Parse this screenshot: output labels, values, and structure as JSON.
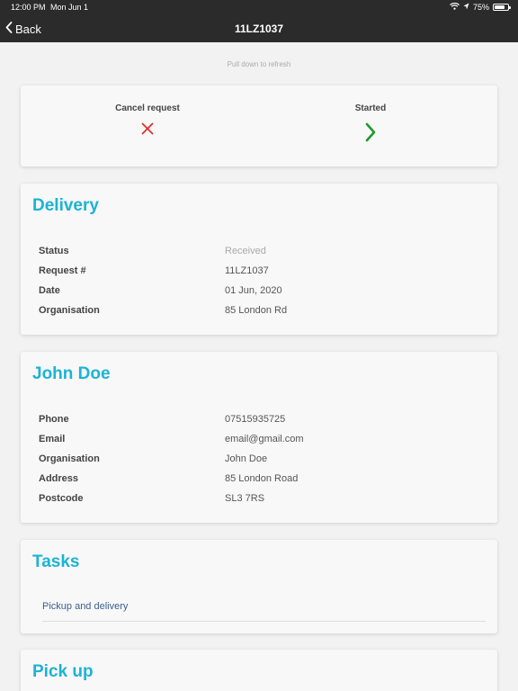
{
  "status_bar": {
    "time": "12:00 PM",
    "date": "Mon Jun 1",
    "battery": "75%"
  },
  "nav": {
    "back_label": "Back",
    "title": "11LZ1037"
  },
  "refresh_hint": "Pull down to refresh",
  "actions": {
    "cancel_label": "Cancel request",
    "started_label": "Started",
    "cancel_color": "#e0302a",
    "started_color": "#1e9a2a"
  },
  "delivery": {
    "title": "Delivery",
    "rows": [
      {
        "label": "Status",
        "value": "Received"
      },
      {
        "label": "Request #",
        "value": "11LZ1037"
      },
      {
        "label": "Date",
        "value": "01 Jun, 2020"
      },
      {
        "label": "Organisation",
        "value": "85 London Rd"
      }
    ]
  },
  "contact": {
    "title": "John Doe",
    "rows": [
      {
        "label": "Phone",
        "value": "07515935725"
      },
      {
        "label": "Email",
        "value": "email@gmail.com"
      },
      {
        "label": "Organisation",
        "value": "John Doe"
      },
      {
        "label": "Address",
        "value": "85 London Road"
      },
      {
        "label": "Postcode",
        "value": "SL3 7RS"
      }
    ]
  },
  "tasks": {
    "title": "Tasks",
    "items": [
      "Pickup and delivery"
    ]
  },
  "pickup": {
    "title": "Pick up"
  },
  "accent_color": "#1cb3d4"
}
